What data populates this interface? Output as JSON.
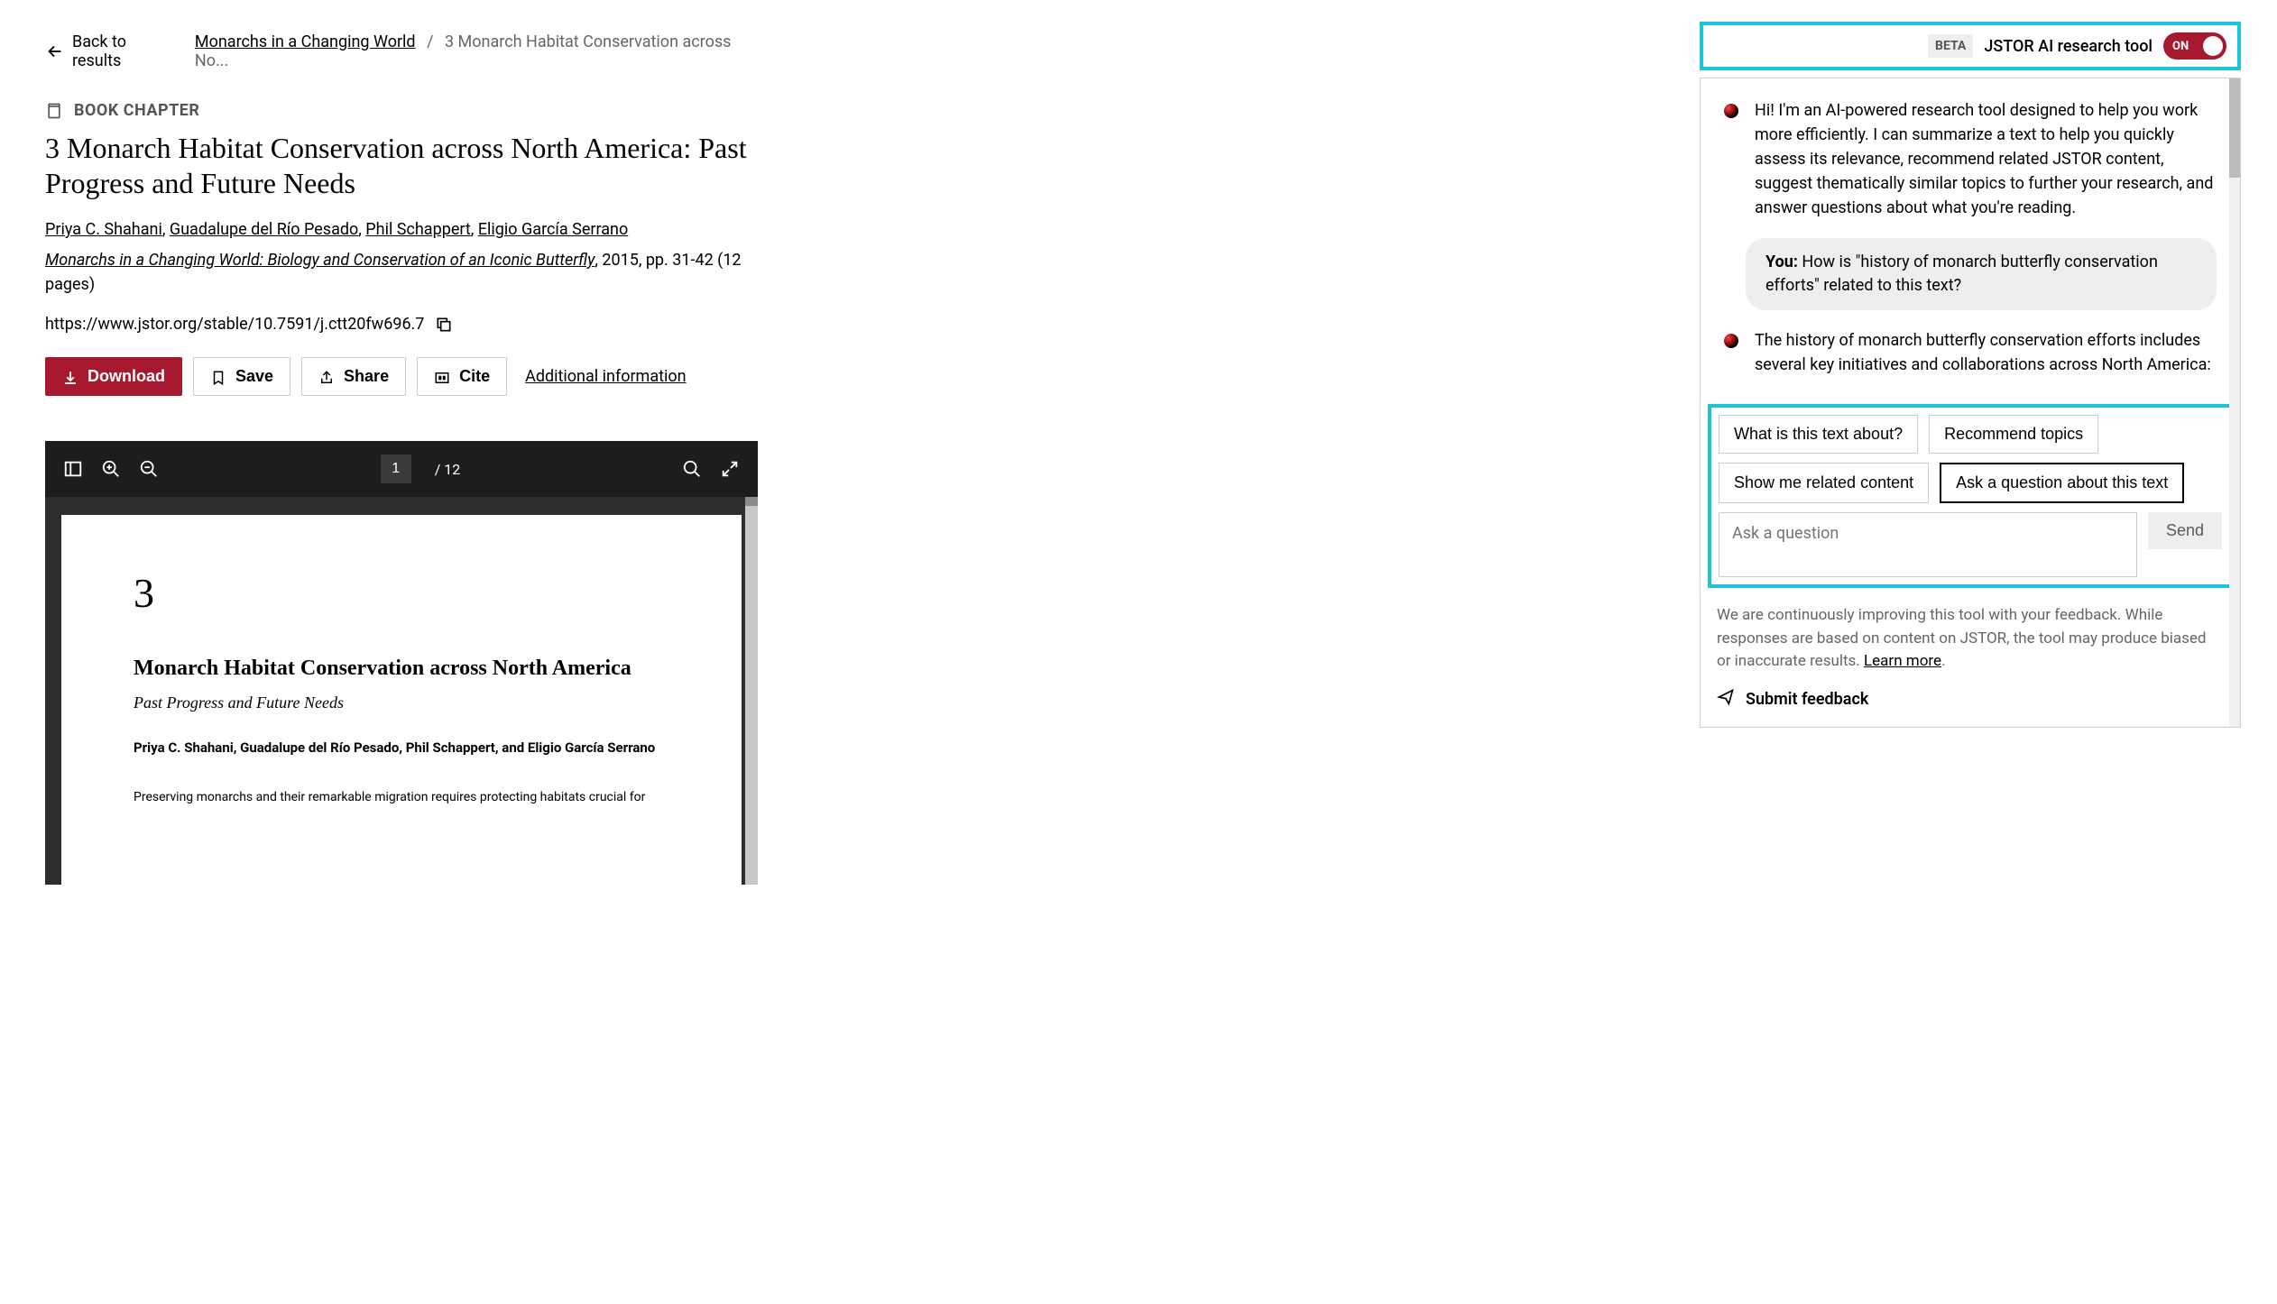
{
  "nav": {
    "back_label": "Back to results",
    "breadcrumb_link": "Monarchs in a Changing World",
    "breadcrumb_current": "3 Monarch Habitat Conservation across No..."
  },
  "content_type": "BOOK CHAPTER",
  "title": "3 Monarch Habitat Conservation across North America: Past Progress and Future Needs",
  "authors": [
    "Priya C. Shahani",
    "Guadalupe del Río Pesado",
    "Phil Schappert",
    "Eligio García Serrano"
  ],
  "source": {
    "book_title": "Monarchs in a Changing World: Biology and Conservation of an Iconic Butterfly",
    "rest": ", 2015, pp. 31-42 (12 pages)"
  },
  "url": "https://www.jstor.org/stable/10.7591/j.ctt20fw696.7",
  "actions": {
    "download": "Download",
    "save": "Save",
    "share": "Share",
    "cite": "Cite",
    "additional": "Additional information"
  },
  "pdf": {
    "page_current": "1",
    "page_sep": "/ 12",
    "chapter_num": "3",
    "chapter_title": "Monarch Habitat Conservation across North America",
    "chapter_subtitle": "Past Progress and Future Needs",
    "chapter_authors": "Priya C. Shahani, Guadalupe del Río Pesado, Phil Schappert, and Eligio García Serrano",
    "body_preview": "Preserving monarchs and their remarkable migration requires protecting habitats crucial for"
  },
  "ai_tool": {
    "beta": "BETA",
    "label": "JSTOR AI research tool",
    "toggle_state": "ON",
    "intro": "Hi! I'm an AI-powered research tool designed to help you work more efficiently. I can summarize a text to help you quickly assess its relevance, recommend related JSTOR content, suggest thematically similar topics to further your research, and answer questions about what you're reading.",
    "user_label": "You:",
    "user_msg": " How is \"history of monarch butterfly conservation efforts\" related to this text?",
    "ai_reply": "The history of monarch butterfly conservation efforts includes several key initiatives and collaborations across North America:",
    "suggestions": {
      "about": "What is this text about?",
      "topics": "Recommend topics",
      "related": "Show me related content",
      "ask": "Ask a question about this text"
    },
    "input_placeholder": "Ask a question",
    "send": "Send",
    "disclaimer_pre": "We are continuously improving this tool with your feedback. While responses are based on content on JSTOR, the tool may produce biased or inaccurate results. ",
    "learn_more": "Learn more",
    "feedback": "Submit feedback"
  }
}
